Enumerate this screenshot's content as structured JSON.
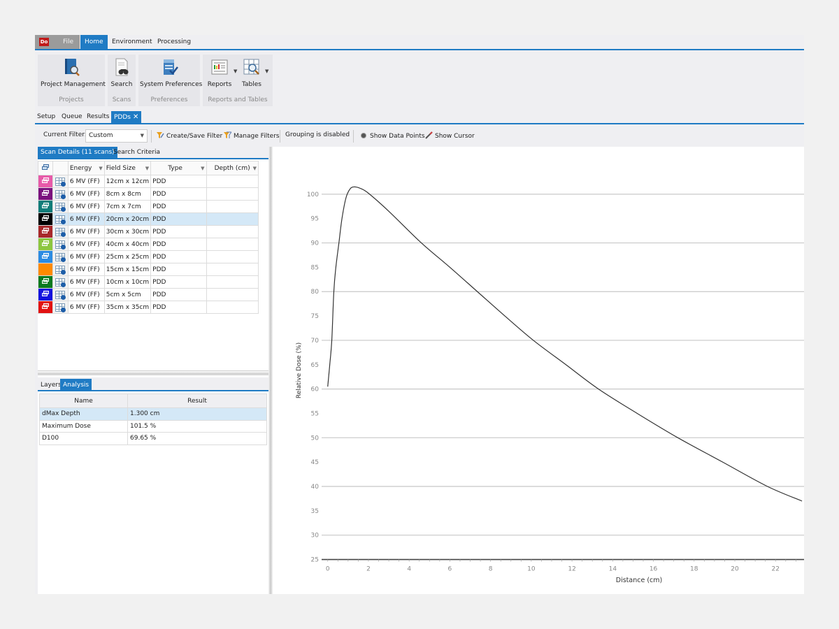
{
  "app": {
    "logo": "Do",
    "menu_tabs": [
      {
        "label": "File",
        "active": false
      },
      {
        "label": "Home",
        "active": true
      },
      {
        "label": "Environment",
        "active": false
      },
      {
        "label": "Processing",
        "active": false
      }
    ]
  },
  "ribbon": {
    "groups": [
      {
        "label": "Projects",
        "buttons": [
          {
            "label": "Project Management",
            "icon": "project-book-icon"
          }
        ]
      },
      {
        "label": "Scans",
        "buttons": [
          {
            "label": "Search",
            "icon": "binoculars-icon"
          }
        ]
      },
      {
        "label": "Preferences",
        "buttons": [
          {
            "label": "System Preferences",
            "icon": "server-check-icon"
          }
        ]
      },
      {
        "label": "Reports and Tables",
        "buttons": [
          {
            "label": "Reports",
            "icon": "report-icon",
            "dropdown": true
          },
          {
            "label": "Tables",
            "icon": "table-search-icon",
            "dropdown": true
          }
        ]
      }
    ]
  },
  "doc_tabs": [
    {
      "label": "Setup",
      "active": false
    },
    {
      "label": "Queue",
      "active": false
    },
    {
      "label": "Results",
      "active": false
    },
    {
      "label": "PDDs",
      "active": true,
      "closable": true,
      "close_glyph": "✕"
    }
  ],
  "toolbar": {
    "filter_label": "Current Filter:",
    "filter_value": "Custom",
    "create_save_filter": "Create/Save Filter",
    "manage_filters": "Manage Filters",
    "grouping_status": "Grouping is disabled",
    "show_data_points": "Show Data Points",
    "show_cursor": "Show Cursor"
  },
  "scan_panel": {
    "tabs": [
      {
        "label": "Scan Details (11 scans)",
        "active": true
      },
      {
        "label": "Search Criteria",
        "active": false
      }
    ],
    "columns": [
      "Energy",
      "Field Size",
      "Type",
      "Depth (cm)"
    ],
    "rows": [
      {
        "color": "#e75aa9",
        "energy": "6 MV  (FF)",
        "field_size": "12cm x 12cm",
        "type": "PDD",
        "depth": "",
        "selected": false
      },
      {
        "color": "#7a127e",
        "energy": "6 MV  (FF)",
        "field_size": "8cm x 8cm",
        "type": "PDD",
        "depth": "",
        "selected": false
      },
      {
        "color": "#0e7d79",
        "energy": "6 MV  (FF)",
        "field_size": "7cm x 7cm",
        "type": "PDD",
        "depth": "",
        "selected": false
      },
      {
        "color": "#000000",
        "energy": "6 MV  (FF)",
        "field_size": "20cm x 20cm",
        "type": "PDD",
        "depth": "",
        "selected": true
      },
      {
        "color": "#a8292b",
        "energy": "6 MV  (FF)",
        "field_size": "30cm x 30cm",
        "type": "PDD",
        "depth": "",
        "selected": false
      },
      {
        "color": "#8cc63f",
        "energy": "6 MV  (FF)",
        "field_size": "40cm x 40cm",
        "type": "PDD",
        "depth": "",
        "selected": false
      },
      {
        "color": "#2b8be2",
        "energy": "6 MV  (FF)",
        "field_size": "25cm x 25cm",
        "type": "PDD",
        "depth": "",
        "selected": false
      },
      {
        "color": "#ff8a00",
        "energy": "6 MV  (FF)",
        "field_size": "15cm x 15cm",
        "type": "PDD",
        "depth": "",
        "selected": false
      },
      {
        "color": "#0b7a1f",
        "energy": "6 MV  (FF)",
        "field_size": "10cm x 10cm",
        "type": "PDD",
        "depth": "",
        "selected": false
      },
      {
        "color": "#1212de",
        "energy": "6 MV  (FF)",
        "field_size": "5cm x 5cm",
        "type": "PDD",
        "depth": "",
        "selected": false
      },
      {
        "color": "#e21212",
        "energy": "6 MV  (FF)",
        "field_size": "35cm x 35cm",
        "type": "PDD",
        "depth": "",
        "selected": false
      }
    ]
  },
  "analysis_panel": {
    "tabs": [
      {
        "label": "Layers",
        "active": false
      },
      {
        "label": "Analysis",
        "active": true
      }
    ],
    "columns": [
      "Name",
      "Result"
    ],
    "rows": [
      {
        "name": "dMax Depth",
        "result": "1.300 cm",
        "selected": true
      },
      {
        "name": "Maximum Dose",
        "result": "101.5 %",
        "selected": false
      },
      {
        "name": "D100",
        "result": "69.65 %",
        "selected": false
      }
    ]
  },
  "chart_data": {
    "type": "line",
    "title": "",
    "xlabel": "Distance (cm)",
    "ylabel": "Relative Dose (%)",
    "xlim": [
      -0.3,
      23.4
    ],
    "ylim": [
      24.5,
      104
    ],
    "xticks": [
      0,
      2,
      4,
      6,
      8,
      10,
      12,
      14,
      16,
      18,
      20,
      22
    ],
    "yticks": [
      25,
      30,
      35,
      40,
      45,
      50,
      55,
      60,
      65,
      70,
      75,
      80,
      85,
      90,
      95,
      100
    ],
    "gridlines_y": [
      30,
      40,
      50,
      60,
      70,
      80,
      90,
      100
    ],
    "grid": true,
    "legend": "none",
    "line_color": "#333333",
    "series": [
      {
        "name": "6 MV (FF) 20cm x 20cm PDD",
        "x": [
          0,
          0.1,
          0.2,
          0.3,
          0.4,
          0.55,
          0.7,
          0.9,
          1.1,
          1.3,
          1.6,
          2.0,
          3.0,
          4.6,
          6.0,
          7.35,
          8.7,
          10.1,
          11.7,
          13.3,
          15.2,
          17.2,
          19.4,
          21.6,
          23.3
        ],
        "y": [
          60.5,
          65,
          70,
          80,
          85,
          90,
          95,
          99.3,
          101.1,
          101.5,
          101.2,
          100.2,
          96.5,
          90,
          85,
          80,
          75,
          70,
          65,
          60,
          55,
          50,
          45,
          40,
          37
        ]
      }
    ]
  }
}
